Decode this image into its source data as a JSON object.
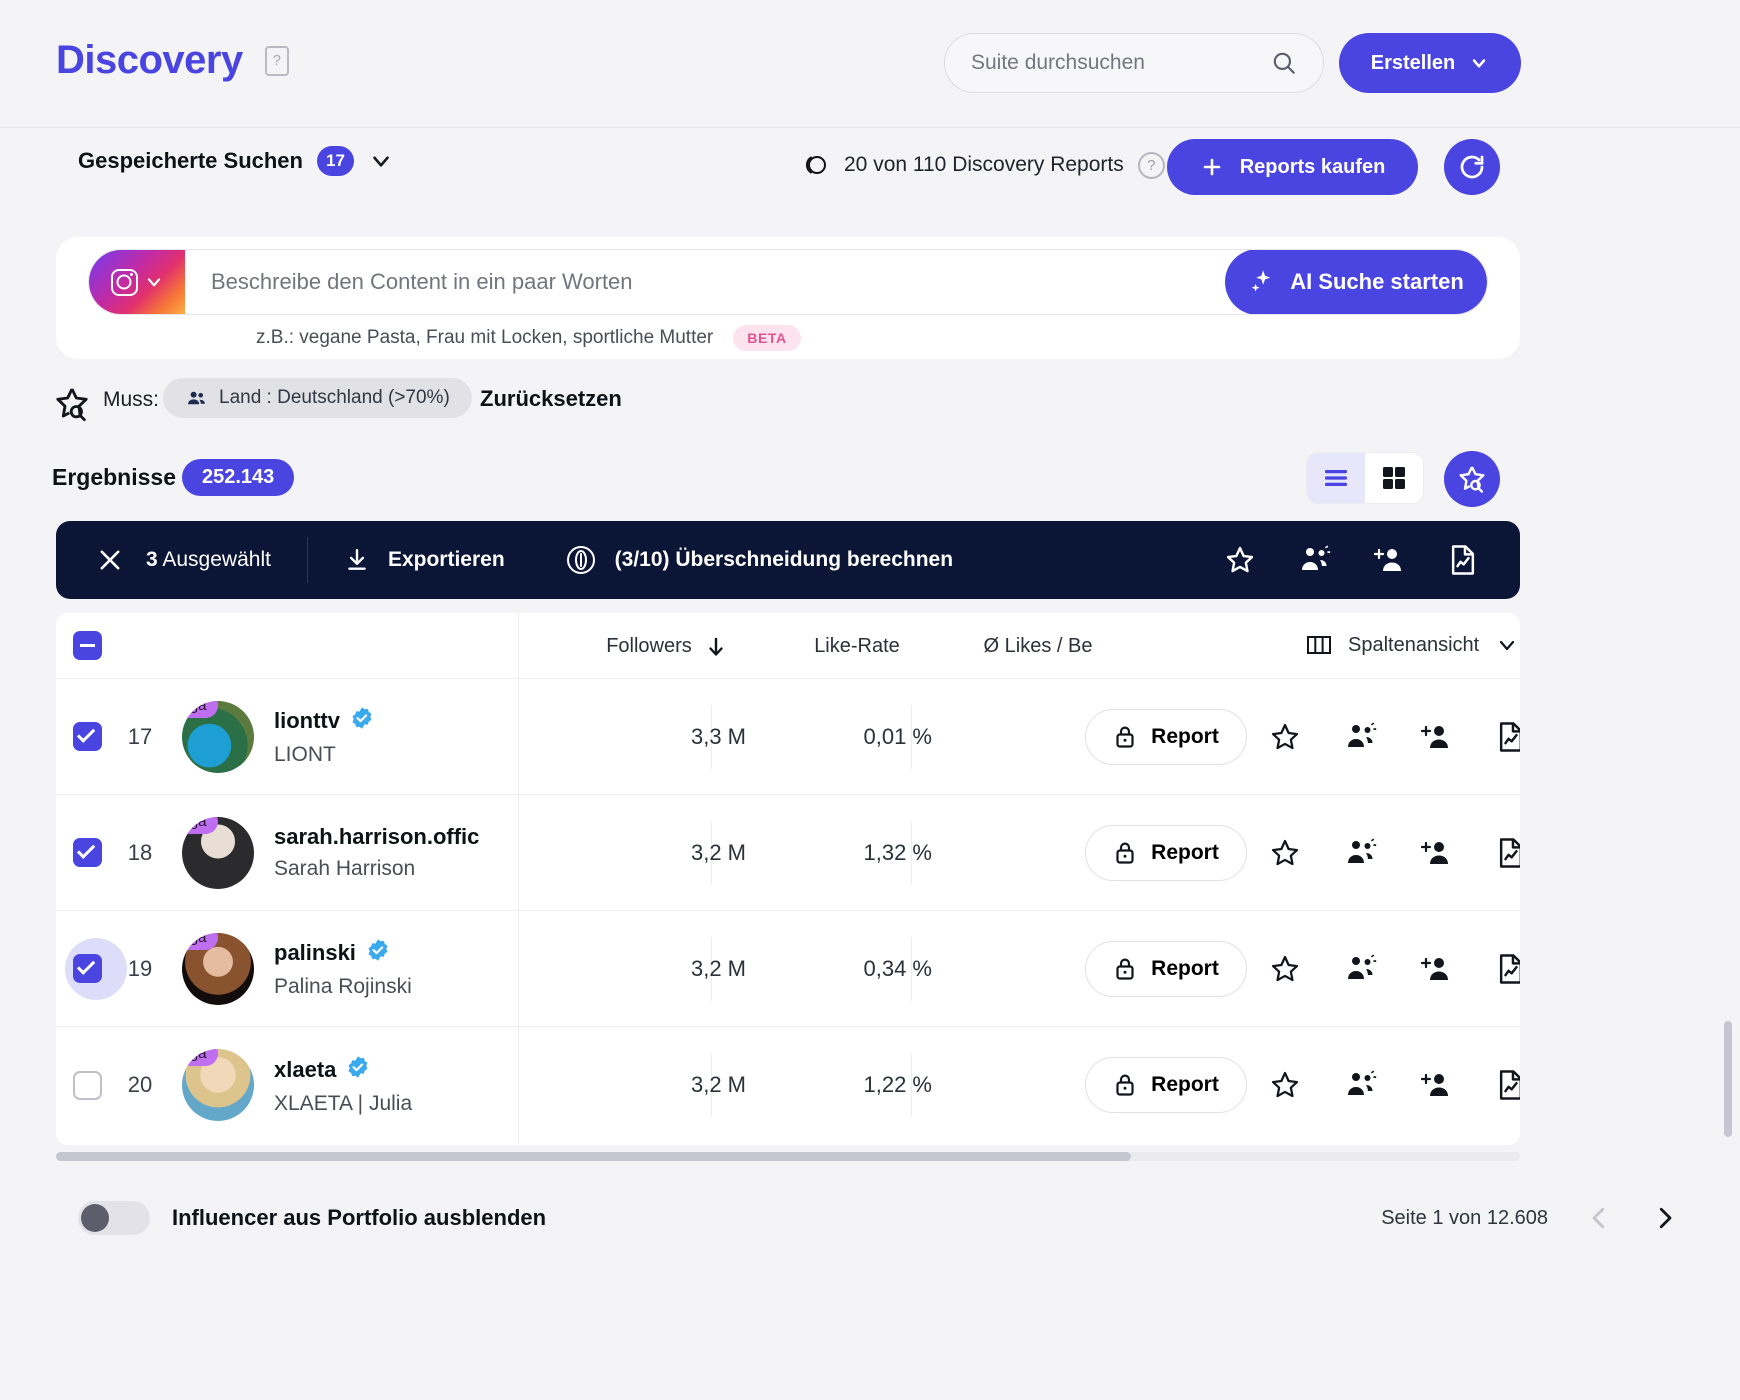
{
  "header": {
    "brand": "Discovery",
    "guide_icon": "guide-book-icon",
    "search": {
      "placeholder": "Suite durchsuchen",
      "value": "",
      "icon": "search-icon"
    },
    "create_button": {
      "label": "Erstellen",
      "icon": "chevron-down-icon"
    }
  },
  "saved_searches": {
    "label": "Gespeicherte Suchen",
    "count": "17",
    "chevron": "chevron-down-icon"
  },
  "reports": {
    "icon": "coin-icon",
    "text": "20 von 110 Discovery Reports",
    "help": "?",
    "buy_button": {
      "label": "Reports kaufen",
      "icon": "plus-icon"
    },
    "refresh_button": {
      "icon": "refresh-icon"
    }
  },
  "ai_search": {
    "platform": "instagram",
    "platform_icon": "instagram-icon",
    "chevron": "chevron-down-icon",
    "placeholder": "Beschreibe den Content in ein paar Worten",
    "value": "",
    "cta": {
      "label": "AI Suche starten",
      "icon": "sparkle-icon"
    },
    "hint": "z.B.: vegane Pasta, Frau mit Locken, sportliche Mutter",
    "beta_badge": "BETA"
  },
  "filters": {
    "star_icon": "saved-search-star-icon",
    "must_label": "Muss:",
    "chips": [
      {
        "icon": "people-icon",
        "label": "Land : Deutschland (>70%)"
      }
    ],
    "reset_label": "Zurücksetzen"
  },
  "results": {
    "label": "Ergebnisse",
    "count": "252.143",
    "view_list_icon": "list-view-icon",
    "view_grid_icon": "grid-view-icon",
    "active_view": "list",
    "save_search_icon": "save-search-icon"
  },
  "action_bar": {
    "close_icon": "close-icon",
    "selected_count": "3",
    "selected_label": "Ausgewählt",
    "export": {
      "label": "Exportieren",
      "icon": "download-icon"
    },
    "overlap": {
      "label": "(3/10) Überschneidung berechnen",
      "icon": "overlap-icon"
    },
    "icons": [
      "star-icon",
      "audience-icon",
      "add-user-icon",
      "report-file-icon"
    ]
  },
  "table": {
    "select_all_state": "indeterminate",
    "columns": {
      "followers": "Followers",
      "followers_sort": "sort-desc-arrow-icon",
      "like_rate": "Like-Rate",
      "avg_likes": "Ø Likes / Be",
      "column_view": "Spaltenansicht",
      "column_view_icon": "columns-icon",
      "column_view_chevron": "chevron-down-icon"
    },
    "rows": [
      {
        "rank": "17",
        "checked": true,
        "highlight": false,
        "tier": "Mega",
        "handle": "lionttv",
        "verified": true,
        "name": "LIONT",
        "followers": "3,3 M",
        "like_rate": "0,01 %",
        "avg_likes": "",
        "report_label": "Report",
        "report_icon": "lock-icon",
        "avatar_class": "av-lionttv"
      },
      {
        "rank": "18",
        "checked": true,
        "highlight": false,
        "tier": "Mega",
        "handle": "sarah.harrison.offic",
        "verified": false,
        "name": "Sarah Harrison",
        "followers": "3,2 M",
        "like_rate": "1,32 %",
        "avg_likes": "",
        "report_label": "Report",
        "report_icon": "lock-icon",
        "avatar_class": "av-sarah"
      },
      {
        "rank": "19",
        "checked": true,
        "highlight": true,
        "tier": "Mega",
        "handle": "palinski",
        "verified": true,
        "name": "Palina Rojinski",
        "followers": "3,2 M",
        "like_rate": "0,34 %",
        "avg_likes": "",
        "report_label": "Report",
        "report_icon": "lock-icon",
        "avatar_class": "av-palinski"
      },
      {
        "rank": "20",
        "checked": false,
        "highlight": false,
        "tier": "Mega",
        "handle": "xlaeta",
        "verified": true,
        "name": "XLAETA | Julia",
        "followers": "3,2 M",
        "like_rate": "1,22 %",
        "avg_likes": "",
        "report_label": "Report",
        "report_icon": "lock-icon",
        "avatar_class": "av-xlaeta"
      }
    ],
    "row_icons": [
      "star-icon",
      "audience-icon",
      "add-user-icon",
      "report-file-icon"
    ]
  },
  "footer": {
    "toggle_label": "Influencer aus Portfolio ausblenden",
    "toggle_on": false,
    "page_text": "Seite 1 von 12.608",
    "prev_icon": "chevron-left-icon",
    "next_icon": "chevron-right-icon"
  },
  "colors": {
    "accent": "#4a44e0",
    "dark_bar": "#0b1636",
    "page_bg": "#f4f4f6",
    "mega_badge": "#c06ef0",
    "verified": "#3ba9ee",
    "beta_bg": "#fde3ee",
    "beta_text": "#e0548f"
  }
}
